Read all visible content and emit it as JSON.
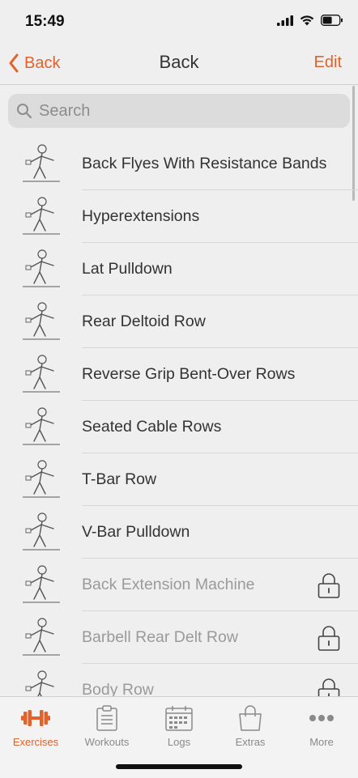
{
  "status": {
    "time": "15:49"
  },
  "nav": {
    "back_label": "Back",
    "title": "Back",
    "edit_label": "Edit"
  },
  "search": {
    "placeholder": "Search"
  },
  "exercises": [
    {
      "name": "Back Flyes With Resistance Bands",
      "locked": false
    },
    {
      "name": "Hyperextensions",
      "locked": false
    },
    {
      "name": "Lat Pulldown",
      "locked": false
    },
    {
      "name": "Rear Deltoid Row",
      "locked": false
    },
    {
      "name": "Reverse Grip Bent-Over Rows",
      "locked": false
    },
    {
      "name": "Seated Cable Rows",
      "locked": false
    },
    {
      "name": "T-Bar Row",
      "locked": false
    },
    {
      "name": "V-Bar Pulldown",
      "locked": false
    },
    {
      "name": "Back Extension Machine",
      "locked": true
    },
    {
      "name": "Barbell Rear Delt Row",
      "locked": true
    },
    {
      "name": "Body Row",
      "locked": true
    }
  ],
  "tabs": [
    {
      "label": "Exercises",
      "icon": "dumbbell-icon",
      "active": true
    },
    {
      "label": "Workouts",
      "icon": "clipboard-icon",
      "active": false
    },
    {
      "label": "Logs",
      "icon": "calendar-icon",
      "active": false
    },
    {
      "label": "Extras",
      "icon": "shopping-bag-icon",
      "active": false
    },
    {
      "label": "More",
      "icon": "more-dots-icon",
      "active": false
    }
  ],
  "colors": {
    "accent": "#e2622b",
    "background": "#efefef",
    "locked_text": "#9a9a9a"
  }
}
